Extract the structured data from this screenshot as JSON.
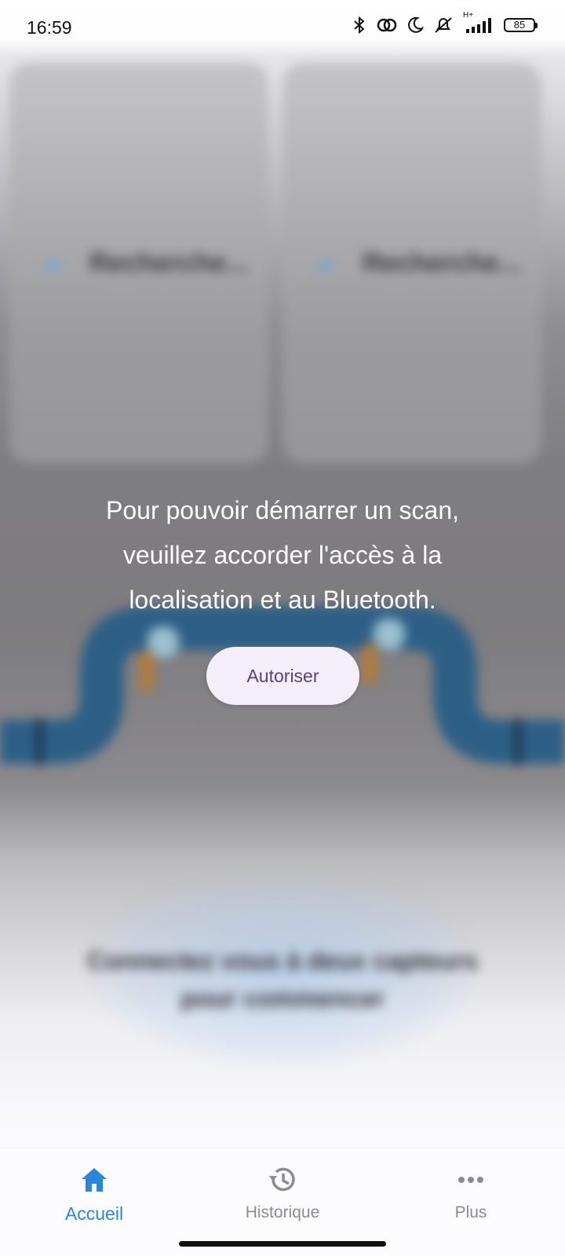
{
  "status_bar": {
    "time": "16:59",
    "battery": "85",
    "network": "H+",
    "icons": [
      "bluetooth-icon",
      "sync-icon",
      "moon-icon",
      "muted-bell-icon",
      "signal-icon",
      "battery-icon"
    ]
  },
  "background": {
    "cards": [
      {
        "label": "Recherche..."
      },
      {
        "label": "Recherche..."
      }
    ],
    "prompt_line1": "Connectez vous à deux capteurs",
    "prompt_line2": "pour commencer"
  },
  "permission": {
    "message_line1": "Pour pouvoir démarrer un scan,",
    "message_line2": "veuillez accorder l'accès à la",
    "message_line3": "localisation et au Bluetooth.",
    "button_label": "Autoriser"
  },
  "nav": {
    "items": [
      {
        "label": "Accueil",
        "icon": "home-icon",
        "active": true
      },
      {
        "label": "Historique",
        "icon": "history-icon",
        "active": false
      },
      {
        "label": "Plus",
        "icon": "more-icon",
        "active": false
      }
    ]
  },
  "colors": {
    "accent": "#2a86d8",
    "button_text": "#5a3f86",
    "button_bg": "#f3eef8",
    "pipe": "#2d5f86"
  }
}
